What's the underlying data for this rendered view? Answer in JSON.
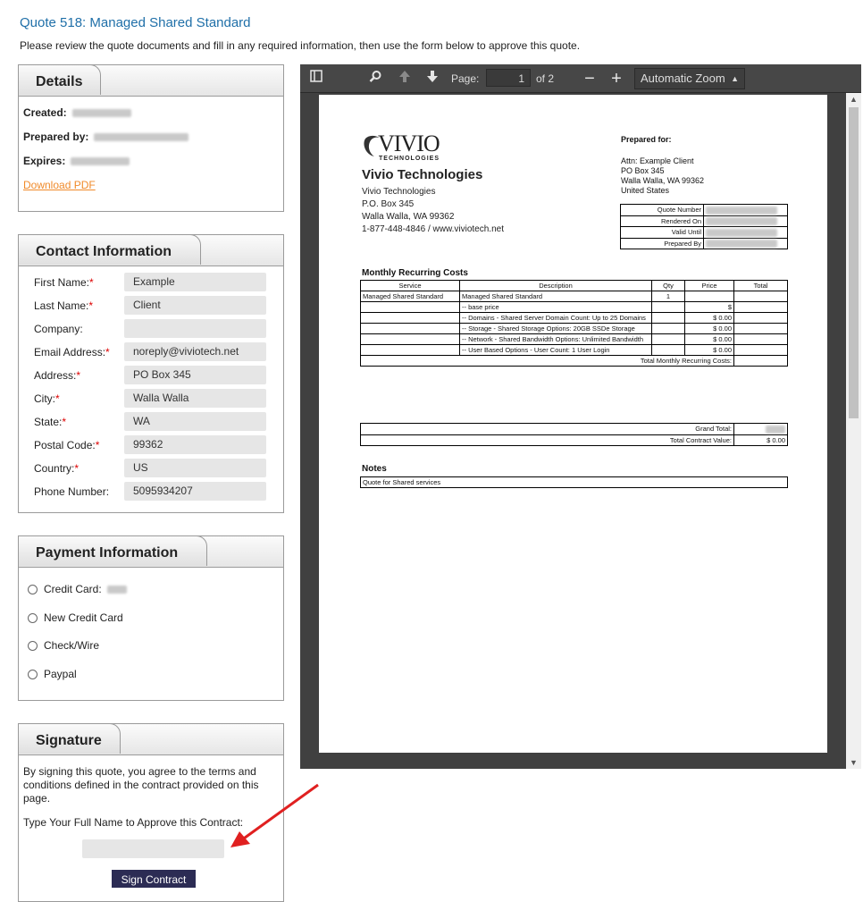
{
  "page": {
    "title": "Quote 518: Managed Shared Standard",
    "intro": "Please review the quote documents and fill in any required information, then use the form below to approve this quote."
  },
  "details": {
    "heading": "Details",
    "created_label": "Created:",
    "prepared_label": "Prepared by:",
    "expires_label": "Expires:",
    "download_link": "Download PDF"
  },
  "contact": {
    "heading": "Contact Information",
    "fields": [
      {
        "label": "First Name:",
        "required": "*",
        "value": "Example"
      },
      {
        "label": "Last Name:",
        "required": "*",
        "value": "Client"
      },
      {
        "label": "Company:",
        "required": "",
        "value": ""
      },
      {
        "label": "Email Address:",
        "required": "*",
        "value": "noreply@viviotech.net"
      },
      {
        "label": "Address:",
        "required": "*",
        "value": "PO Box 345"
      },
      {
        "label": "City:",
        "required": "*",
        "value": "Walla Walla"
      },
      {
        "label": "State:",
        "required": "*",
        "value": "WA"
      },
      {
        "label": "Postal Code:",
        "required": "*",
        "value": "99362"
      },
      {
        "label": "Country:",
        "required": "*",
        "value": "US"
      },
      {
        "label": "Phone Number:",
        "required": "",
        "value": "5095934207"
      }
    ]
  },
  "payment": {
    "heading": "Payment Information",
    "options": [
      "Credit Card:",
      "New Credit Card",
      "Check/Wire",
      "Paypal"
    ]
  },
  "signature": {
    "heading": "Signature",
    "terms": "By signing this quote, you agree to the terms and conditions defined in the contract provided on this page.",
    "prompt": "Type Your Full Name to Approve this Contract:",
    "button": "Sign Contract"
  },
  "viewer": {
    "page_label": "Page:",
    "page_value": "1",
    "page_of": "of 2",
    "zoom": "Automatic Zoom",
    "icons": [
      "sidebar-toggle-icon",
      "search-icon",
      "previous-page-icon",
      "next-page-icon",
      "zoom-out-icon",
      "zoom-in-icon"
    ]
  },
  "pdf": {
    "logo_text": "VIVIO",
    "logo_sub": "TECHNOLOGIES",
    "company_name": "Vivio Technologies",
    "address": [
      "Vivio Technologies",
      "P.O. Box 345",
      "Walla Walla, WA 99362",
      "1-877-448-4846 / www.viviotech.net"
    ],
    "prepared_for_label": "Prepared for:",
    "client_address": [
      "Attn: Example Client",
      "PO Box 345",
      "Walla Walla, WA 99362",
      "United States"
    ],
    "info_labels": [
      "Quote Number",
      "Rendered On",
      "Valid Until",
      "Prepared By"
    ],
    "mrc_heading": "Monthly Recurring Costs",
    "columns": [
      "Service",
      "Description",
      "Qty",
      "Price",
      "Total"
    ],
    "rows": [
      {
        "service": "Managed Shared Standard",
        "description": "Managed Shared Standard",
        "qty": "1",
        "price": "",
        "total": ""
      },
      {
        "service": "",
        "description": "-- base price",
        "qty": "",
        "price": "$",
        "total": ""
      },
      {
        "service": "",
        "description": "-- Domains - Shared Server Domain Count: Up to 25 Domains",
        "qty": "",
        "price": "$ 0.00",
        "total": ""
      },
      {
        "service": "",
        "description": "-- Storage - Shared Storage Options: 20GB SSDe Storage",
        "qty": "",
        "price": "$ 0.00",
        "total": ""
      },
      {
        "service": "",
        "description": "-- Network - Shared Bandwidth Options: Unlimited Bandwidth",
        "qty": "",
        "price": "$ 0.00",
        "total": ""
      },
      {
        "service": "",
        "description": "-- User Based Options - User Count: 1 User Login",
        "qty": "",
        "price": "$ 0.00",
        "total": ""
      }
    ],
    "total_mrc_label": "Total Monthly Recurring Costs:",
    "grand_total_label": "Grand Total:",
    "contract_value_label": "Total Contract Value:",
    "contract_value": "$ 0.00",
    "notes_heading": "Notes",
    "notes_text": "Quote for Shared services"
  },
  "colors": {
    "accent_title": "#1f6fa8",
    "link": "#f08a2a",
    "required": "#dd0000",
    "button": "#2c2c54",
    "annotation_arrow": "#e02020"
  }
}
